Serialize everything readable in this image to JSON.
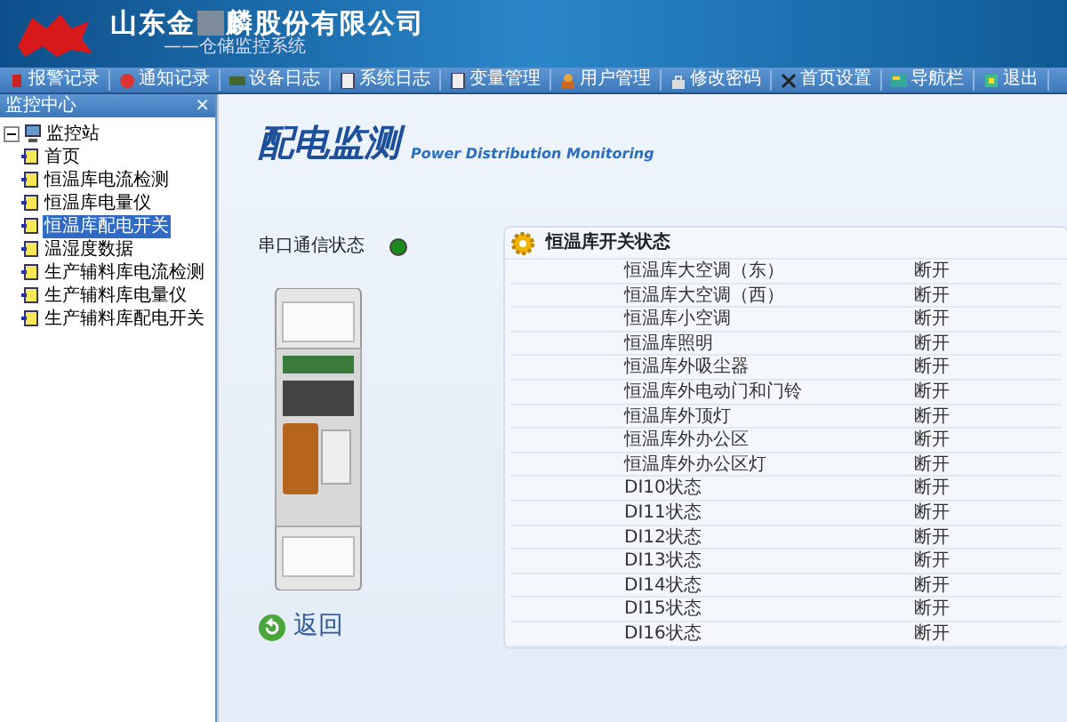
{
  "header": {
    "company_name_start": "山东金",
    "company_name_end": "麟股份有限公司",
    "subtitle": "——仓储监控系统"
  },
  "menu": [
    {
      "label": "报警记录"
    },
    {
      "label": "通知记录"
    },
    {
      "label": "设备日志"
    },
    {
      "label": "系统日志"
    },
    {
      "label": "变量管理"
    },
    {
      "label": "用户管理"
    },
    {
      "label": "修改密码"
    },
    {
      "label": "首页设置"
    },
    {
      "label": "导航栏"
    },
    {
      "label": "退出"
    }
  ],
  "sidebar": {
    "title": "监控中心",
    "close": "×",
    "tree": {
      "label": "监控站",
      "expanded": true,
      "children": [
        {
          "label": "首页",
          "selected": false
        },
        {
          "label": "恒温库电流检测",
          "selected": false
        },
        {
          "label": "恒温库电量仪",
          "selected": false
        },
        {
          "label": "恒温库配电开关",
          "selected": true
        },
        {
          "label": "温湿度数据",
          "selected": false
        },
        {
          "label": "生产辅料库电流检测",
          "selected": false
        },
        {
          "label": "生产辅料库电量仪",
          "selected": false
        },
        {
          "label": "生产辅料库配电开关",
          "selected": false
        }
      ]
    }
  },
  "page": {
    "title": "配电监测",
    "subtitle": "Power Distribution Monitoring"
  },
  "comm_status": {
    "label": "串口通信状态",
    "on": true
  },
  "back_button": "返回",
  "panel": {
    "title": "恒温库开关状态",
    "rows": [
      {
        "name": "恒温库大空调（东）",
        "state": "断开"
      },
      {
        "name": "恒温库大空调（西）",
        "state": "断开"
      },
      {
        "name": "恒温库小空调",
        "state": "断开"
      },
      {
        "name": "恒温库照明",
        "state": "断开"
      },
      {
        "name": "恒温库外吸尘器",
        "state": "断开"
      },
      {
        "name": "恒温库外电动门和门铃",
        "state": "断开"
      },
      {
        "name": "恒温库外顶灯",
        "state": "断开"
      },
      {
        "name": "恒温库外办公区",
        "state": "断开"
      },
      {
        "name": "恒温库外办公区灯",
        "state": "断开"
      },
      {
        "name": "DI10状态",
        "state": "断开"
      },
      {
        "name": "DI11状态",
        "state": "断开"
      },
      {
        "name": "DI12状态",
        "state": "断开"
      },
      {
        "name": "DI13状态",
        "state": "断开"
      },
      {
        "name": "DI14状态",
        "state": "断开"
      },
      {
        "name": "DI15状态",
        "state": "断开"
      },
      {
        "name": "DI16状态",
        "state": "断开"
      }
    ]
  }
}
